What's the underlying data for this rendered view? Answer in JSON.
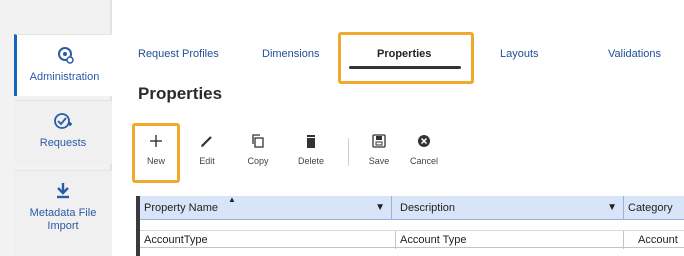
{
  "sidebar": {
    "items": [
      {
        "label": "Administration",
        "icon": "admin-gear-icon",
        "active": true
      },
      {
        "label": "Requests",
        "icon": "requests-check-icon",
        "active": false
      },
      {
        "label": "Metadata File Import",
        "icon": "download-icon",
        "active": false
      }
    ]
  },
  "tabs": [
    {
      "label": "Request Profiles"
    },
    {
      "label": "Dimensions"
    },
    {
      "label": "Properties",
      "active": true
    },
    {
      "label": "Layouts"
    },
    {
      "label": "Validations"
    }
  ],
  "page_title": "Properties",
  "toolbar": {
    "buttons": [
      {
        "label": "New",
        "icon": "plus-icon"
      },
      {
        "label": "Edit",
        "icon": "pencil-icon"
      },
      {
        "label": "Copy",
        "icon": "copy-icon"
      },
      {
        "label": "Delete",
        "icon": "trash-icon"
      },
      {
        "label": "Save",
        "icon": "save-icon"
      },
      {
        "label": "Cancel",
        "icon": "cancel-icon"
      }
    ]
  },
  "grid": {
    "columns": [
      "Property Name",
      "Description",
      "Category"
    ],
    "rows": [
      [
        "AccountType",
        "Account Type",
        "Account"
      ]
    ]
  },
  "colors": {
    "accent": "#1565c0",
    "highlight": "#f0a92a",
    "header_bg": "#d8e4f7",
    "link": "#1f4f94"
  }
}
